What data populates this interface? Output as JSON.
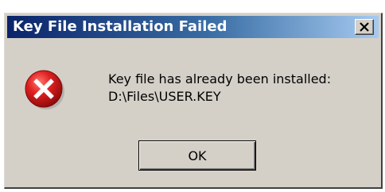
{
  "window": {
    "title": "Key File Installation Failed",
    "close_glyph": "X"
  },
  "icon": {
    "name": "error-icon",
    "color": "#d11a1a"
  },
  "message": {
    "line1": "Key file has already been installed:",
    "line2": "D:\\Files\\USER.KEY"
  },
  "buttons": {
    "ok_label": "OK"
  },
  "colors": {
    "titlebar_start": "#0a246a",
    "titlebar_end": "#a6caf0",
    "dialog_face": "#d4d0c8"
  }
}
